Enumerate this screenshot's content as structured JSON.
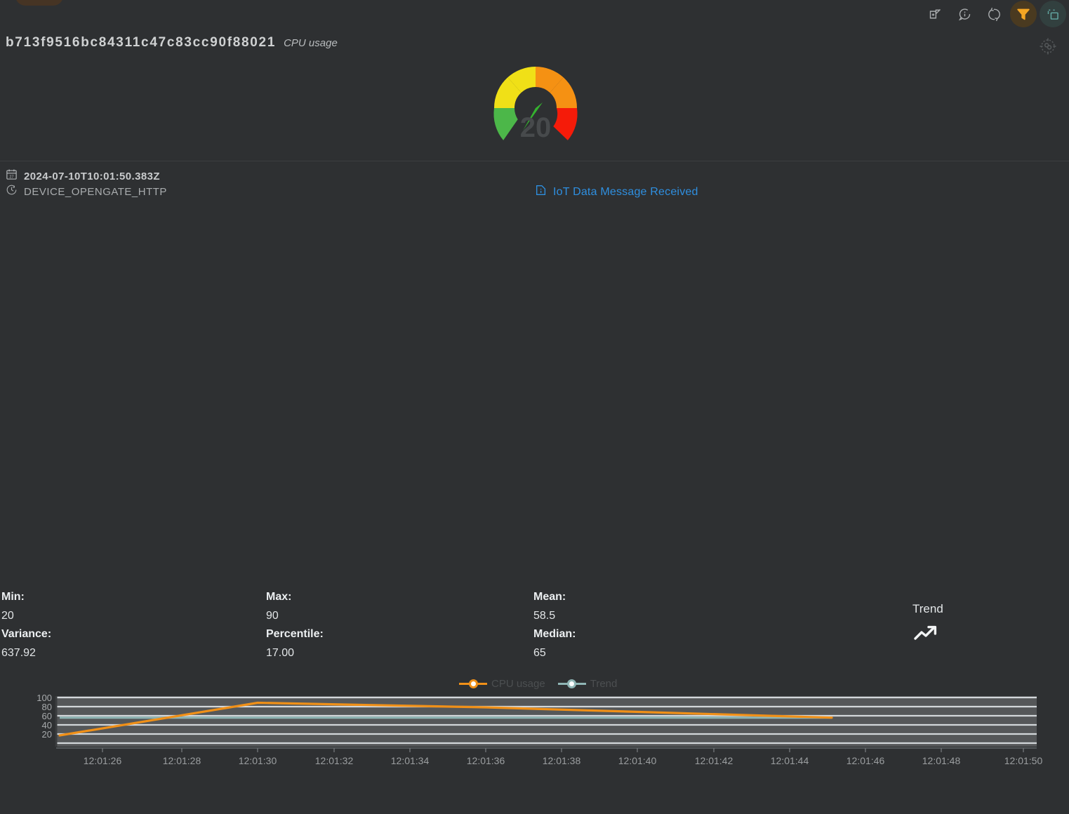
{
  "header": {
    "device_id": "b713f9516bc84311c47c83cc90f88021",
    "metric_name": "CPU usage"
  },
  "toolbar": {
    "items": [
      {
        "name": "export-icon",
        "label": "Export",
        "active": false
      },
      {
        "name": "info-icon",
        "label": "Info",
        "active": false
      },
      {
        "name": "refresh-icon",
        "label": "Refresh",
        "active": false
      },
      {
        "name": "filter-icon",
        "label": "Filter",
        "active": true
      },
      {
        "name": "duplicate-icon",
        "label": "Duplicate",
        "active": true
      }
    ],
    "settings_label": "Settings"
  },
  "gauge": {
    "value": "20",
    "min": 0,
    "max": 100,
    "segments": [
      {
        "name": "green",
        "color": "#4cb749",
        "from": 0,
        "to": 25
      },
      {
        "name": "yellow",
        "color": "#f0e017",
        "from": 25,
        "to": 50
      },
      {
        "name": "orange",
        "color": "#f59113",
        "from": 50,
        "to": 75
      },
      {
        "name": "red",
        "color": "#f51b09",
        "from": 75,
        "to": 100
      }
    ],
    "needle_color": "#35b22f"
  },
  "meta": {
    "timestamp": "2024-07-10T10:01:50.383Z",
    "device_source": "DEVICE_OPENGATE_HTTP",
    "calendar_day": "27"
  },
  "event": {
    "message": "IoT Data Message Received",
    "color": "#2e8fe0"
  },
  "stats": {
    "columns": [
      [
        {
          "label": "Min:",
          "value": "20"
        },
        {
          "label": "Variance:",
          "value": "637.92"
        }
      ],
      [
        {
          "label": "Max:",
          "value": "90"
        },
        {
          "label": "Percentile:",
          "value": "17.00"
        }
      ],
      [
        {
          "label": "Mean:",
          "value": "58.5"
        },
        {
          "label": "Median:",
          "value": "65"
        }
      ]
    ]
  },
  "trend": {
    "label": "Trend",
    "direction": "up"
  },
  "chart_data": {
    "type": "line",
    "title": "",
    "xlabel": "",
    "ylabel": "",
    "grid": true,
    "legend_position": "top-center",
    "ylim": [
      10,
      105
    ],
    "yticks": [
      20,
      40,
      60,
      80,
      100
    ],
    "xticks": [
      "12:01:26",
      "12:01:28",
      "12:01:30",
      "12:01:32",
      "12:01:34",
      "12:01:36",
      "12:01:38",
      "12:01:40",
      "12:01:42",
      "12:01:44",
      "12:01:46",
      "12:01:48",
      "12:01:50"
    ],
    "xlim": [
      "12:01:25",
      "12:01:51"
    ],
    "series": [
      {
        "name": "CPU usage",
        "color": "#f09018",
        "x": [
          "12:01:25",
          "12:01:30",
          "12:01:36",
          "12:01:45"
        ],
        "values": [
          25,
          90,
          80,
          62
        ]
      },
      {
        "name": "Trend",
        "color": "#8fb5b5",
        "x": [
          "12:01:25",
          "12:01:44"
        ],
        "values": [
          62,
          62
        ]
      }
    ]
  }
}
